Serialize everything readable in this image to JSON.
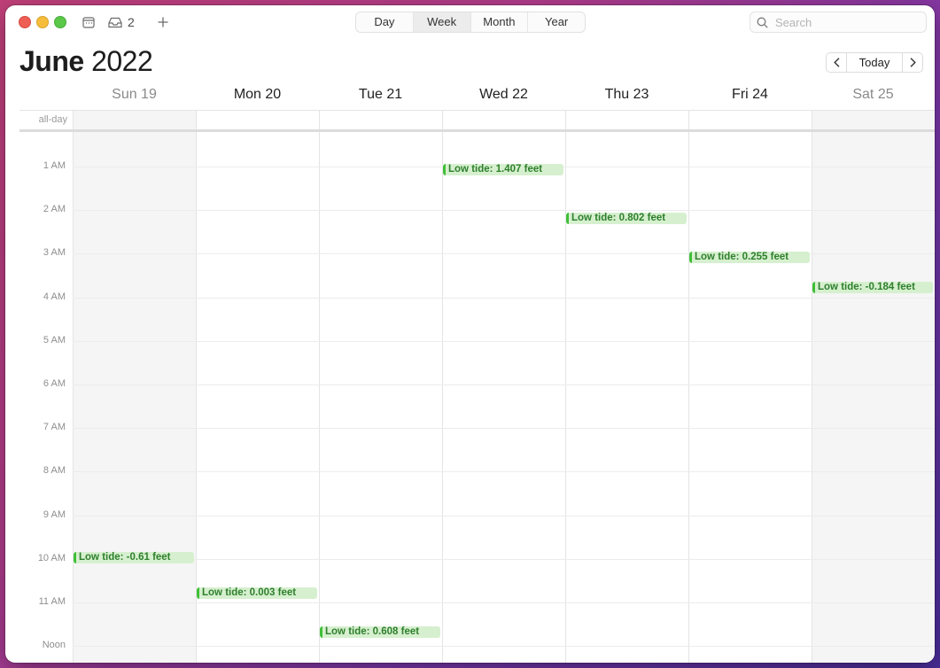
{
  "toolbar": {
    "inbox_count": "2",
    "views": [
      "Day",
      "Week",
      "Month",
      "Year"
    ],
    "active_view": "Week",
    "search_placeholder": "Search"
  },
  "header": {
    "month": "June",
    "year": "2022",
    "today_label": "Today"
  },
  "days": [
    {
      "label": "Sun 19",
      "weekend": true
    },
    {
      "label": "Mon 20",
      "weekend": false
    },
    {
      "label": "Tue 21",
      "weekend": false
    },
    {
      "label": "Wed 22",
      "weekend": false
    },
    {
      "label": "Thu 23",
      "weekend": false
    },
    {
      "label": "Fri 24",
      "weekend": false
    },
    {
      "label": "Sat 25",
      "weekend": true
    }
  ],
  "allday_label": "all-day",
  "hours": [
    "1 AM",
    "2 AM",
    "3 AM",
    "4 AM",
    "5 AM",
    "6 AM",
    "7 AM",
    "8 AM",
    "9 AM",
    "10 AM",
    "11 AM",
    "Noon"
  ],
  "events": [
    {
      "day": 0,
      "hour": 9.97,
      "title": "Low tide: -0.61 feet"
    },
    {
      "day": 1,
      "hour": 10.77,
      "title": "Low tide: 0.003 feet"
    },
    {
      "day": 2,
      "hour": 11.68,
      "title": "Low tide: 0.608 feet"
    },
    {
      "day": 3,
      "hour": 1.07,
      "title": "Low tide: 1.407 feet"
    },
    {
      "day": 4,
      "hour": 2.17,
      "title": "Low tide: 0.802 feet"
    },
    {
      "day": 5,
      "hour": 3.07,
      "title": "Low tide: 0.255 feet"
    },
    {
      "day": 6,
      "hour": 3.77,
      "title": "Low tide: -0.184 feet"
    }
  ],
  "colors": {
    "event_bg": "#d6f0cf",
    "event_bar": "#3fbf37",
    "event_text": "#2e7f2c",
    "weekend_bg": "#f5f5f5"
  }
}
